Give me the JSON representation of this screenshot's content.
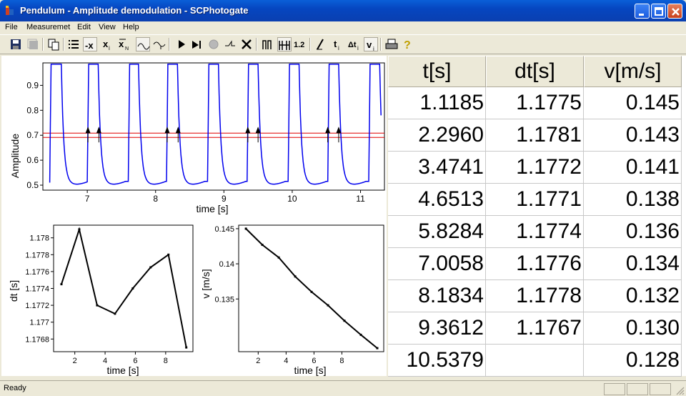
{
  "window": {
    "title": "Pendulum - Amplitude demodulation - SCPhotogate"
  },
  "menu": {
    "items": [
      "File",
      "Measuremet",
      "Edit",
      "View",
      "Help"
    ]
  },
  "status": {
    "text": "Ready"
  },
  "table": {
    "headers": [
      "t[s]",
      "dt[s]",
      "v[m/s]"
    ],
    "rows": [
      [
        "1.1185",
        "1.1775",
        "0.145"
      ],
      [
        "2.2960",
        "1.1781",
        "0.143"
      ],
      [
        "3.4741",
        "1.1772",
        "0.141"
      ],
      [
        "4.6513",
        "1.1771",
        "0.138"
      ],
      [
        "5.8284",
        "1.1774",
        "0.136"
      ],
      [
        "7.0058",
        "1.1776",
        "0.134"
      ],
      [
        "8.1834",
        "1.1778",
        "0.132"
      ],
      [
        "9.3612",
        "1.1767",
        "0.130"
      ],
      [
        "10.5379",
        "",
        "0.128"
      ]
    ]
  },
  "chart_data": [
    {
      "type": "line",
      "xlabel": "time [s]",
      "ylabel": "Amplitude",
      "xlim": [
        6.35,
        11.35
      ],
      "ylim": [
        0.48,
        0.99
      ],
      "xticks": [
        "7",
        "8",
        "9",
        "10",
        "11"
      ],
      "yticks": [
        "0.5",
        "0.6",
        "0.7",
        "0.8",
        "0.9"
      ],
      "threshold": 0.7,
      "pulses": [
        [
          6.45,
          6.62
        ],
        [
          7.0,
          7.16
        ],
        [
          7.6,
          7.75
        ],
        [
          8.16,
          8.32
        ],
        [
          8.76,
          8.92
        ],
        [
          9.34,
          9.5
        ],
        [
          9.94,
          10.1
        ],
        [
          10.52,
          10.68
        ],
        [
          11.12,
          11.28
        ]
      ],
      "markers": [
        7.01,
        7.17,
        8.17,
        8.33,
        9.35,
        9.5,
        10.52,
        10.68
      ],
      "line_color": "#0000ee",
      "threshold_color": "#e00000"
    },
    {
      "type": "line",
      "xlabel": "time [s]",
      "ylabel": "dt [s]",
      "xlim": [
        0.6,
        9.8
      ],
      "ylim": [
        1.17665,
        1.17815
      ],
      "xticks": [
        "2",
        "4",
        "6",
        "8"
      ],
      "yticks": [
        "1.1768",
        "1.177",
        "1.1772",
        "1.1774",
        "1.1776",
        "1.1778",
        "1.178"
      ],
      "x": [
        1.1185,
        2.296,
        3.4741,
        4.6513,
        5.8284,
        7.0058,
        8.1834,
        9.3612
      ],
      "y": [
        1.17745,
        1.1781,
        1.1772,
        1.1771,
        1.1774,
        1.17765,
        1.1778,
        1.1767
      ]
    },
    {
      "type": "line",
      "xlabel": "time [s]",
      "ylabel": "v [m/s]",
      "xlim": [
        0.6,
        11.0
      ],
      "ylim": [
        0.1275,
        0.1455
      ],
      "xticks": [
        "2",
        "4",
        "6",
        "8"
      ],
      "yticks": [
        "0.135",
        "0.14",
        "0.145"
      ],
      "x": [
        1.1185,
        2.296,
        3.4741,
        4.6513,
        5.8284,
        7.0058,
        8.1834,
        9.3612,
        10.5379
      ],
      "y": [
        0.145,
        0.1427,
        0.1409,
        0.1382,
        0.136,
        0.1341,
        0.1319,
        0.1299,
        0.128
      ]
    }
  ]
}
